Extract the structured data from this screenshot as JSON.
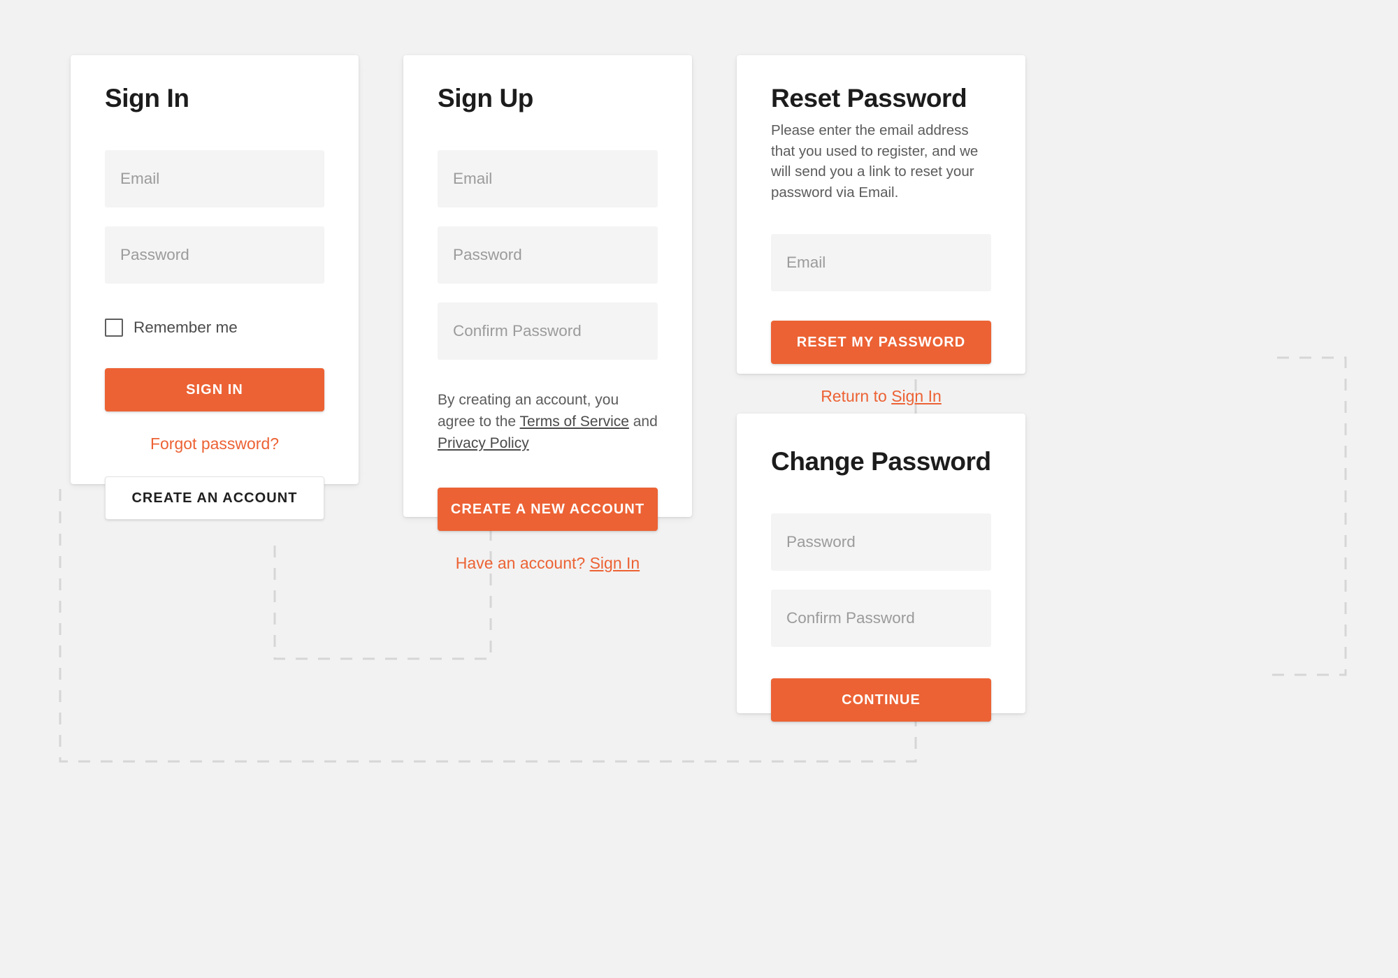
{
  "theme": {
    "accent": "#ec6234",
    "page_background": "#f2f2f2",
    "card_background": "#ffffff",
    "input_background": "#f4f4f4",
    "connector_color": "#d6d6d6"
  },
  "cards": {
    "sign_in": {
      "title": "Sign In",
      "email_placeholder": "Email",
      "password_placeholder": "Password",
      "remember_label": "Remember me",
      "submit_label": "SIGN IN",
      "forgot_label": "Forgot password?",
      "create_label": "CREATE AN ACCOUNT"
    },
    "sign_up": {
      "title": "Sign Up",
      "email_placeholder": "Email",
      "password_placeholder": "Password",
      "confirm_placeholder": "Confirm Password",
      "terms_prefix": "By creating an account, you agree to the ",
      "terms_link": "Terms of Service",
      "terms_middle": " and ",
      "privacy_link": "Privacy Policy",
      "submit_label": "CREATE A NEW ACCOUNT",
      "have_account_prefix": "Have an account? ",
      "have_account_link": "Sign In"
    },
    "reset_password": {
      "title": "Reset Password",
      "description": "Please enter the email address that you used to register, and we will send you a link to reset your password via Email.",
      "email_placeholder": "Email",
      "submit_label": "RESET MY PASSWORD",
      "return_prefix": "Return to ",
      "return_link": "Sign In"
    },
    "change_password": {
      "title": "Change Password",
      "password_placeholder": "Password",
      "confirm_placeholder": "Confirm Password",
      "submit_label": "CONTINUE"
    }
  }
}
